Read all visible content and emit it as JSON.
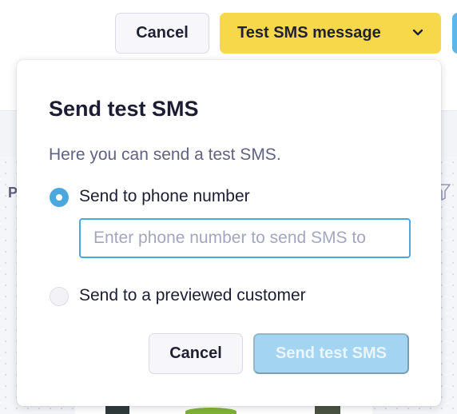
{
  "header": {
    "cancel_label": "Cancel",
    "test_sms_label": "Test SMS message",
    "test_sms_chevron_icon": "chevron-down-icon"
  },
  "background": {
    "partial_letter": "P"
  },
  "dialog": {
    "title": "Send test SMS",
    "description": "Here you can send a test SMS.",
    "options": [
      {
        "label": "Send to phone number",
        "selected": true
      },
      {
        "label": "Send to a previewed customer",
        "selected": false
      }
    ],
    "phone_input": {
      "value": "",
      "placeholder": "Enter phone number to send SMS to"
    },
    "cancel_label": "Cancel",
    "send_label": "Send test SMS",
    "send_disabled": true
  },
  "colors": {
    "accent_yellow": "#f7d84a",
    "accent_blue": "#4aa8de",
    "send_disabled_bg": "#a3d4f1"
  }
}
